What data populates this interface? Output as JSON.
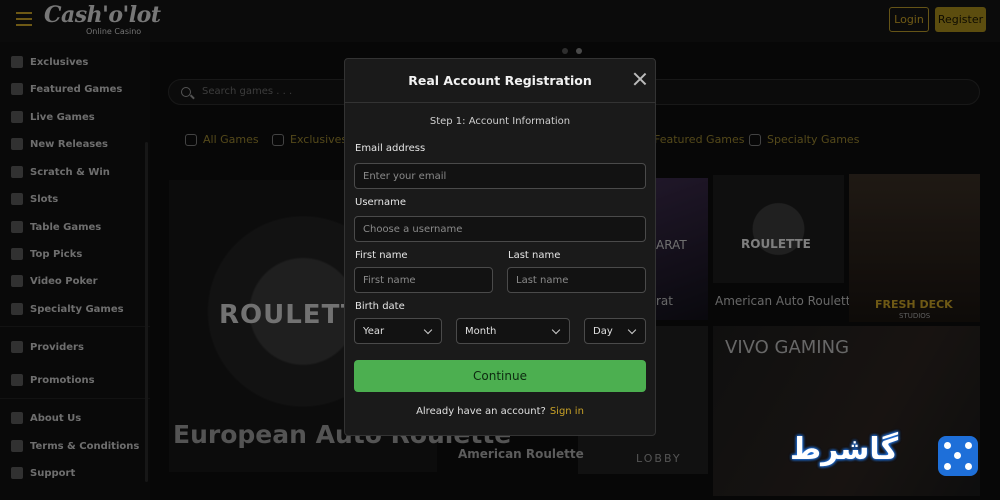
{
  "header": {
    "logo": "Cash'o'lot",
    "logo_sub": "Online Casino",
    "login": "Login",
    "register": "Register"
  },
  "sidebar": {
    "items": [
      {
        "label": "Exclusives",
        "icon": "exclusives-icon"
      },
      {
        "label": "Featured Games",
        "icon": "clover-icon"
      },
      {
        "label": "Live Games",
        "icon": "live-icon"
      },
      {
        "label": "New Releases",
        "icon": "new-icon"
      },
      {
        "label": "Scratch & Win",
        "icon": "scratch-icon"
      },
      {
        "label": "Slots",
        "icon": "slots-icon"
      },
      {
        "label": "Table Games",
        "icon": "table-icon"
      },
      {
        "label": "Top Picks",
        "icon": "trophy-icon"
      },
      {
        "label": "Video Poker",
        "icon": "poker-icon"
      },
      {
        "label": "Specialty Games",
        "icon": "gear-icon"
      },
      {
        "label": "Providers",
        "icon": "providers-icon"
      },
      {
        "label": "Promotions",
        "icon": "gift-icon"
      },
      {
        "label": "About Us",
        "icon": "info-icon"
      },
      {
        "label": "Terms & Conditions",
        "icon": "document-icon"
      },
      {
        "label": "Support",
        "icon": "chat-icon"
      }
    ]
  },
  "search": {
    "placeholder": "Search games . . ."
  },
  "tabs": {
    "all": "All Games",
    "exclusives": "Exclusives",
    "featured": "Featured Games",
    "specialty": "Specialty Games"
  },
  "games": {
    "european_caption": "European Auto Roulette",
    "roulette_tile_text": "ROULETTE",
    "american_tile_text": "ROULETTE",
    "american_caption": "American Auto Roulette",
    "baccarat_tile_text": "ARAT",
    "baccarat_caption": "rat",
    "fresh_deck": "FRESH DECK",
    "fresh_deck_sub": "STUDIOS",
    "vivo": "VIVO GAMING",
    "lobby": "LOBBY",
    "american_roulette": "American Roulette"
  },
  "modal": {
    "title": "Real Account Registration",
    "step": "Step 1: Account Information",
    "email_label": "Email address",
    "email_placeholder": "Enter your email",
    "username_label": "Username",
    "username_placeholder": "Choose a username",
    "firstname_label": "First name",
    "firstname_placeholder": "First name",
    "lastname_label": "Last name",
    "lastname_placeholder": "Last name",
    "birth_label": "Birth date",
    "year": "Year",
    "month": "Month",
    "day": "Day",
    "continue": "Continue",
    "already": "Already have an account?",
    "signin": "Sign in"
  },
  "watermark": "گاشرط"
}
